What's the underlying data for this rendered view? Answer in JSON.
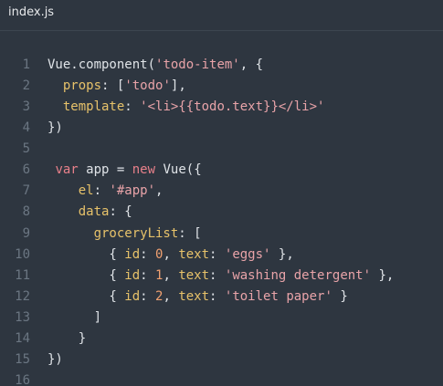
{
  "tab": {
    "filename": "index.js"
  },
  "colors": {
    "background": "#2e3640",
    "line_number": "#6b7682",
    "default": "#dfe3e7",
    "property": "#e7c26a",
    "string": "#e8a3a8",
    "keyword": "#e8808a",
    "number": "#f0a070"
  },
  "lines": [
    {
      "num": "1",
      "tokens": [
        {
          "t": "Vue.component(",
          "c": "ident"
        },
        {
          "t": "'todo-item'",
          "c": "str"
        },
        {
          "t": ", {",
          "c": "punc"
        }
      ]
    },
    {
      "num": "2",
      "tokens": [
        {
          "t": "  ",
          "c": "punc"
        },
        {
          "t": "props",
          "c": "key"
        },
        {
          "t": ": [",
          "c": "punc"
        },
        {
          "t": "'todo'",
          "c": "str"
        },
        {
          "t": "],",
          "c": "punc"
        }
      ]
    },
    {
      "num": "3",
      "tokens": [
        {
          "t": "  ",
          "c": "punc"
        },
        {
          "t": "template",
          "c": "key"
        },
        {
          "t": ": ",
          "c": "punc"
        },
        {
          "t": "'<li>{{todo.text}}</li>'",
          "c": "str"
        }
      ]
    },
    {
      "num": "4",
      "tokens": [
        {
          "t": "})",
          "c": "punc"
        }
      ]
    },
    {
      "num": "5",
      "tokens": []
    },
    {
      "num": "6",
      "tokens": [
        {
          "t": " ",
          "c": "punc"
        },
        {
          "t": "var",
          "c": "kw"
        },
        {
          "t": " app = ",
          "c": "ident"
        },
        {
          "t": "new",
          "c": "kw"
        },
        {
          "t": " Vue({",
          "c": "ident"
        }
      ]
    },
    {
      "num": "7",
      "tokens": [
        {
          "t": "    ",
          "c": "punc"
        },
        {
          "t": "el",
          "c": "key"
        },
        {
          "t": ": ",
          "c": "punc"
        },
        {
          "t": "'#app'",
          "c": "str"
        },
        {
          "t": ",",
          "c": "punc"
        }
      ]
    },
    {
      "num": "8",
      "tokens": [
        {
          "t": "    ",
          "c": "punc"
        },
        {
          "t": "data",
          "c": "key"
        },
        {
          "t": ": {",
          "c": "punc"
        }
      ]
    },
    {
      "num": "9",
      "tokens": [
        {
          "t": "      ",
          "c": "punc"
        },
        {
          "t": "groceryList",
          "c": "key"
        },
        {
          "t": ": [",
          "c": "punc"
        }
      ]
    },
    {
      "num": "10",
      "tokens": [
        {
          "t": "        { ",
          "c": "punc"
        },
        {
          "t": "id",
          "c": "key"
        },
        {
          "t": ": ",
          "c": "punc"
        },
        {
          "t": "0",
          "c": "num"
        },
        {
          "t": ", ",
          "c": "punc"
        },
        {
          "t": "text",
          "c": "key"
        },
        {
          "t": ": ",
          "c": "punc"
        },
        {
          "t": "'eggs'",
          "c": "str"
        },
        {
          "t": " },",
          "c": "punc"
        }
      ]
    },
    {
      "num": "11",
      "tokens": [
        {
          "t": "        { ",
          "c": "punc"
        },
        {
          "t": "id",
          "c": "key"
        },
        {
          "t": ": ",
          "c": "punc"
        },
        {
          "t": "1",
          "c": "num"
        },
        {
          "t": ", ",
          "c": "punc"
        },
        {
          "t": "text",
          "c": "key"
        },
        {
          "t": ": ",
          "c": "punc"
        },
        {
          "t": "'washing detergent'",
          "c": "str"
        },
        {
          "t": " },",
          "c": "punc"
        }
      ]
    },
    {
      "num": "12",
      "tokens": [
        {
          "t": "        { ",
          "c": "punc"
        },
        {
          "t": "id",
          "c": "key"
        },
        {
          "t": ": ",
          "c": "punc"
        },
        {
          "t": "2",
          "c": "num"
        },
        {
          "t": ", ",
          "c": "punc"
        },
        {
          "t": "text",
          "c": "key"
        },
        {
          "t": ": ",
          "c": "punc"
        },
        {
          "t": "'toilet paper'",
          "c": "str"
        },
        {
          "t": " }",
          "c": "punc"
        }
      ]
    },
    {
      "num": "13",
      "tokens": [
        {
          "t": "      ]",
          "c": "punc"
        }
      ]
    },
    {
      "num": "14",
      "tokens": [
        {
          "t": "    }",
          "c": "punc"
        }
      ]
    },
    {
      "num": "15",
      "tokens": [
        {
          "t": "})",
          "c": "punc"
        }
      ]
    },
    {
      "num": "16",
      "tokens": []
    }
  ]
}
